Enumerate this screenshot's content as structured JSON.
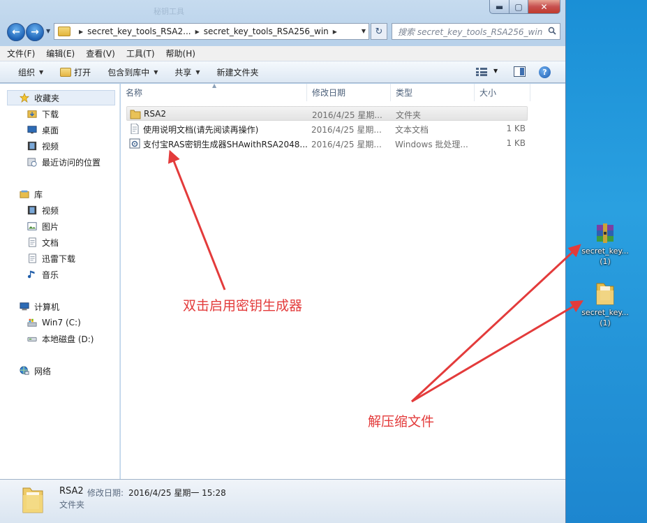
{
  "window": {
    "title_ghost": "秘钥工具",
    "caption": {
      "minimize": "▬",
      "maximize": "▢",
      "close": "✕"
    }
  },
  "address": {
    "crumbs": [
      "secret_key_tools_RSA2...",
      "secret_key_tools_RSA256_win"
    ],
    "search_placeholder": "搜索 secret_key_tools_RSA256_win"
  },
  "menu": [
    "文件(F)",
    "编辑(E)",
    "查看(V)",
    "工具(T)",
    "帮助(H)"
  ],
  "commands": {
    "organize": "组织",
    "open": "打开",
    "include_library": "包含到库中",
    "share": "共享",
    "new_folder": "新建文件夹"
  },
  "nav": {
    "favorites": "收藏夹",
    "downloads": "下载",
    "desktop": "桌面",
    "videos": "视频",
    "recent": "最近访问的位置",
    "libraries": "库",
    "lib_videos": "视频",
    "lib_pictures": "图片",
    "lib_documents": "文档",
    "lib_thunder": "迅雷下载",
    "lib_music": "音乐",
    "computer": "计算机",
    "drive_c": "Win7 (C:)",
    "drive_d": "本地磁盘 (D:)",
    "network": "网络"
  },
  "columns": {
    "name": "名称",
    "date": "修改日期",
    "type": "类型",
    "size": "大小"
  },
  "files": [
    {
      "name": "RSA2",
      "date": "2016/4/25 星期...",
      "type": "文件夹",
      "size": ""
    },
    {
      "name": "使用说明文档(请先阅读再操作)",
      "date": "2016/4/25 星期...",
      "type": "文本文档",
      "size": "1 KB"
    },
    {
      "name": "支付宝RAS密钥生成器SHAwithRSA2048...",
      "date": "2016/4/25 星期...",
      "type": "Windows 批处理...",
      "size": "1 KB"
    }
  ],
  "details": {
    "name": "RSA2",
    "date_label": "修改日期:",
    "date": "2016/4/25 星期一 15:28",
    "type": "文件夹"
  },
  "desktop_icons": [
    {
      "name": "secret_key...",
      "sub": "(1)",
      "kind": "winrar-archive-icon"
    },
    {
      "name": "secret_key...",
      "sub": "(1)",
      "kind": "folder-icon"
    }
  ],
  "annotations": {
    "double_click": "双击启用密钥生成器",
    "extract": "解压缩文件",
    "color": "#e33b3b"
  }
}
